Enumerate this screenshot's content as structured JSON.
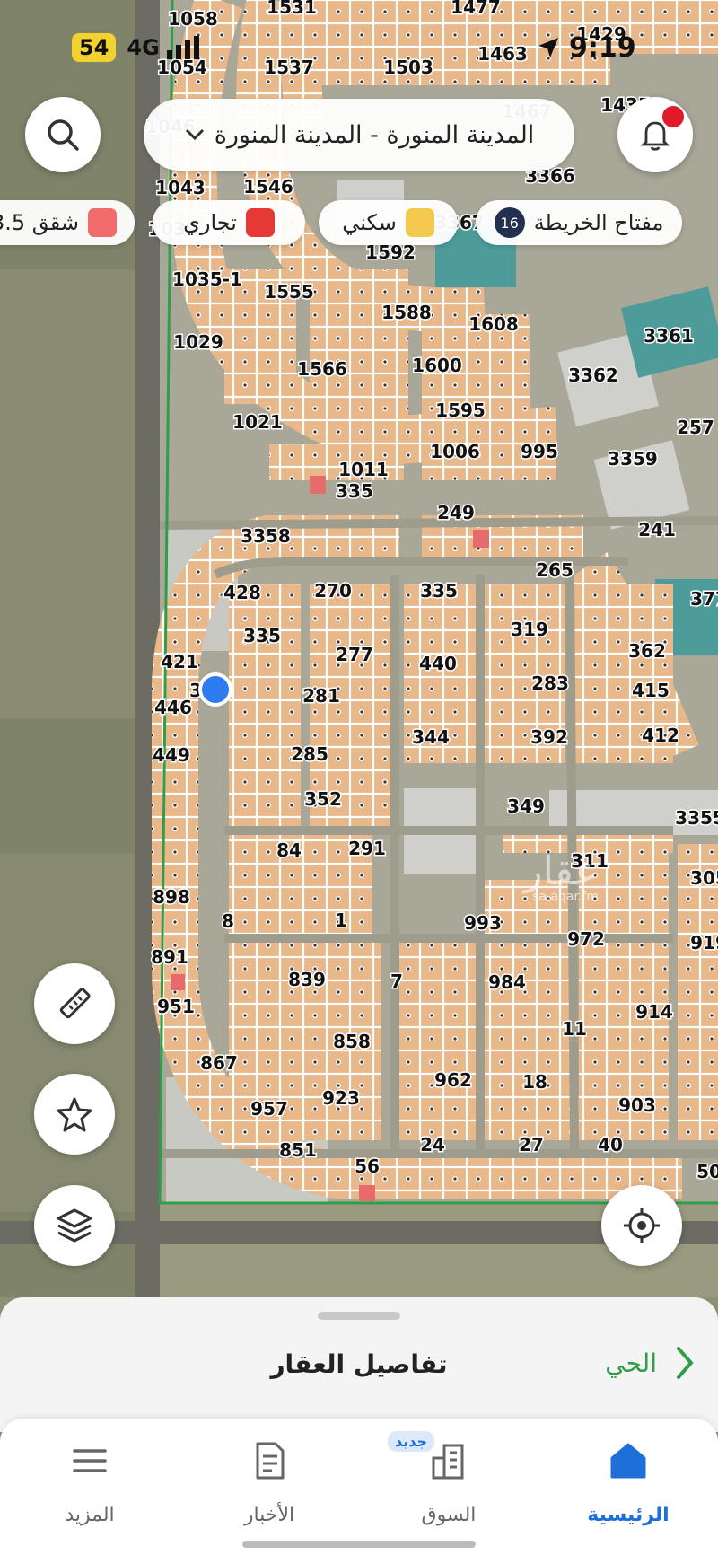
{
  "status_bar": {
    "battery": "54",
    "network": "4G",
    "time": "9:19"
  },
  "search": {
    "location_text": "المدينة المنورة - المدينة المنورة"
  },
  "legend": {
    "map_key_label": "مفتاح الخريطة",
    "map_key_count": "16",
    "items": [
      {
        "label": "سكني",
        "color": "#f2c94c"
      },
      {
        "label": "تجاري",
        "color": "#e53935"
      },
      {
        "label": "شقق 3.5",
        "color": "#f26b6b"
      }
    ]
  },
  "map": {
    "watermark_brand": "عقار",
    "watermark_url": "sa.aqar.fm",
    "parcel_labels": [
      "1058",
      "1531",
      "1477",
      "1463",
      "1429",
      "1054",
      "1537",
      "1503",
      "1467",
      "1435",
      "1046",
      "1543",
      "3366",
      "1043",
      "1546",
      "3367",
      "1039",
      "1592",
      "1035-1",
      "1555",
      "1588",
      "1608",
      "3361",
      "1029",
      "1566",
      "1600",
      "3362",
      "1021",
      "1595",
      "335",
      "1006",
      "995",
      "3359",
      "1011",
      "257",
      "249",
      "241",
      "3358",
      "265",
      "428",
      "270",
      "335",
      "377",
      "335",
      "319",
      "421",
      "277",
      "362",
      "440",
      "385",
      "283",
      "415",
      "446",
      "281",
      "344",
      "392",
      "412",
      "449",
      "285",
      "349",
      "352",
      "3355",
      "84",
      "291",
      "311",
      "305",
      "898",
      "8",
      "1",
      "993",
      "972",
      "919",
      "891",
      "839",
      "7",
      "984",
      "951",
      "914",
      "11",
      "858",
      "867",
      "962",
      "18",
      "923",
      "903",
      "957",
      "851",
      "24",
      "27",
      "40",
      "50",
      "56",
      "6",
      "33"
    ]
  },
  "sheet": {
    "district_label": "الحي",
    "title": "تفاصيل العقار"
  },
  "tabs": [
    {
      "label": "الرئيسية",
      "active": true
    },
    {
      "label": "السوق",
      "badge": "جديد"
    },
    {
      "label": "الأخبار"
    },
    {
      "label": "المزيد"
    }
  ],
  "colors": {
    "accent": "#1e6fd8",
    "district_green": "#2e9e48",
    "notification": "#e0192b",
    "parcel_fill": "#e8b88a",
    "map_key_badge": "#23304f"
  }
}
